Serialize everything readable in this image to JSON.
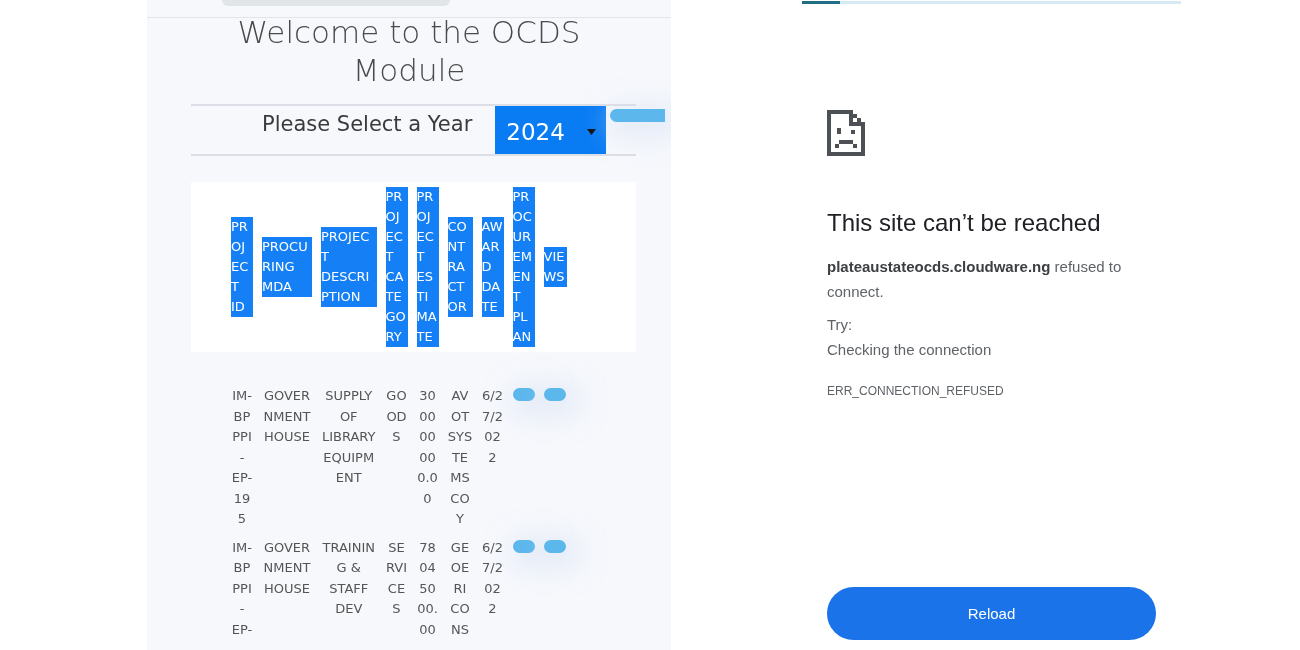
{
  "ocds_page": {
    "heading": "Welcome to the OCDS Module",
    "year_selector": {
      "label": "Please Select a Year",
      "value": "2024"
    },
    "table": {
      "columns": [
        "PROJECT ID",
        "PROCURING MDA",
        "PROJECT DESCRIPTION",
        "PROJECT CATEGORY",
        "PROJECT ESTIMATE",
        "CONTRACTOR",
        "AWARD DATE",
        "PROCUREMENT PLAN",
        "VIEWS"
      ],
      "rows": [
        {
          "cells": [
            {
              "kind": "text",
              "text": "IM-BPPPI-EP-195"
            },
            {
              "kind": "text",
              "text": "GOVERNMENT HOUSE"
            },
            {
              "kind": "text",
              "text": "SUPPLY OF LIBRARY EQUIPMENT"
            },
            {
              "kind": "text",
              "text": "GOODS"
            },
            {
              "kind": "text",
              "text": "300000000.00"
            },
            {
              "kind": "text",
              "text": "AVOT SYSTEMS COY"
            },
            {
              "kind": "text",
              "text": "6/27/2022"
            },
            {
              "kind": "button"
            },
            {
              "kind": "button"
            }
          ]
        },
        {
          "cells": [
            {
              "kind": "text",
              "text": "IM-BPPPI-EP-"
            },
            {
              "kind": "text",
              "text": "GOVERNMENT HOUSE"
            },
            {
              "kind": "text",
              "text": "TRAINING & STAFF DEV"
            },
            {
              "kind": "text",
              "text": "SERVICES"
            },
            {
              "kind": "text",
              "text": "78045000.00"
            },
            {
              "kind": "text",
              "text": "GEOERI CONS"
            },
            {
              "kind": "text",
              "text": "6/27/2022"
            },
            {
              "kind": "button"
            },
            {
              "kind": "button"
            }
          ]
        }
      ]
    }
  },
  "error_page": {
    "loading": {
      "level": 0.1
    },
    "title": "This site can’t be reached",
    "message": "**plateaustateocds.cloudware.ng** refused to connect.",
    "try_label": "Try:",
    "suggestions": [
      "Checking the connection"
    ],
    "error_code": "ERR_CONNECTION_REFUSED",
    "button": "Reload"
  }
}
